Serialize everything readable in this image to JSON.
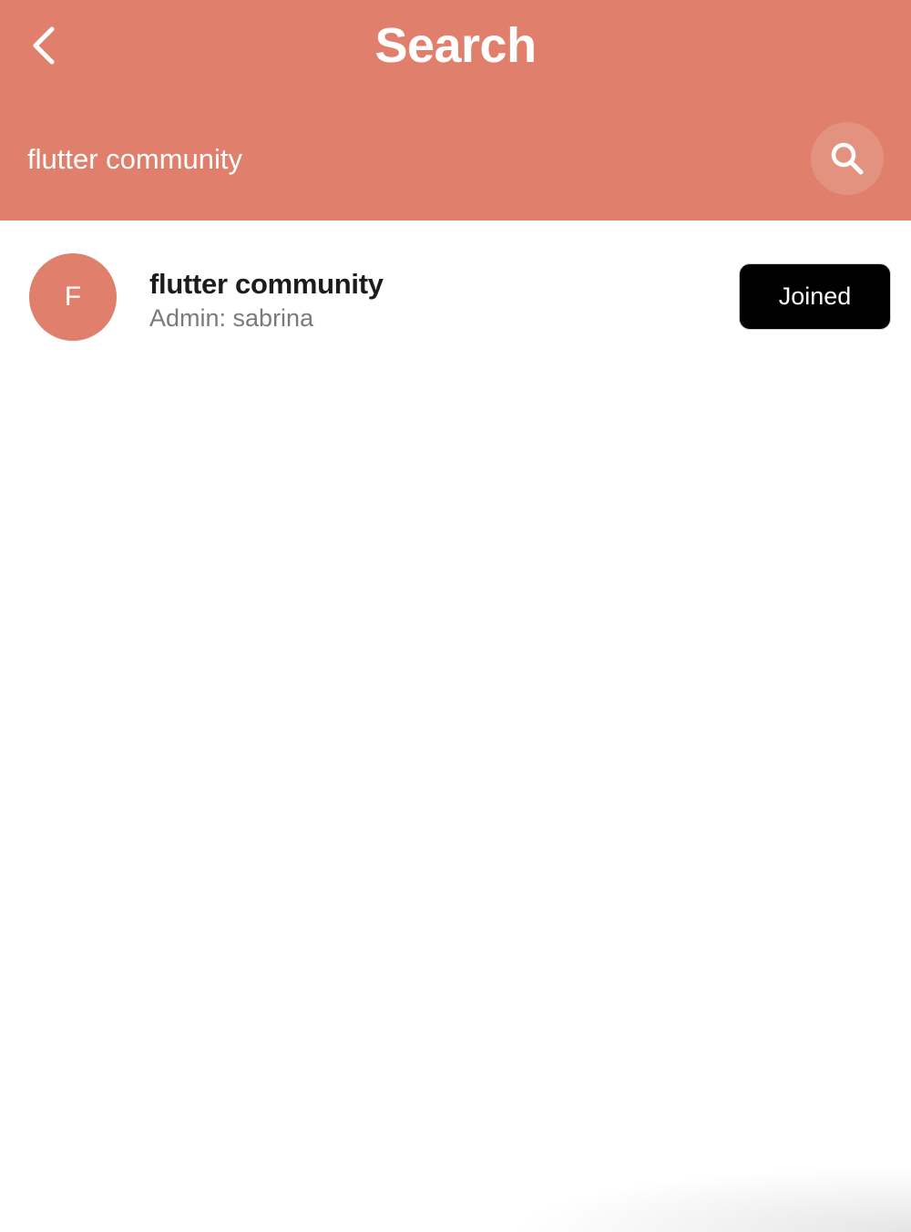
{
  "header": {
    "title": "Search",
    "back_icon": "chevron-left-icon",
    "search_icon": "search-icon",
    "background_color": "#E0806C"
  },
  "search": {
    "value": "flutter community",
    "placeholder": ""
  },
  "results": [
    {
      "avatar_letter": "F",
      "name": "flutter community",
      "admin": "Admin: sabrina",
      "action_label": "Joined",
      "avatar_color": "#E0806C",
      "action_color": "#000000"
    }
  ]
}
